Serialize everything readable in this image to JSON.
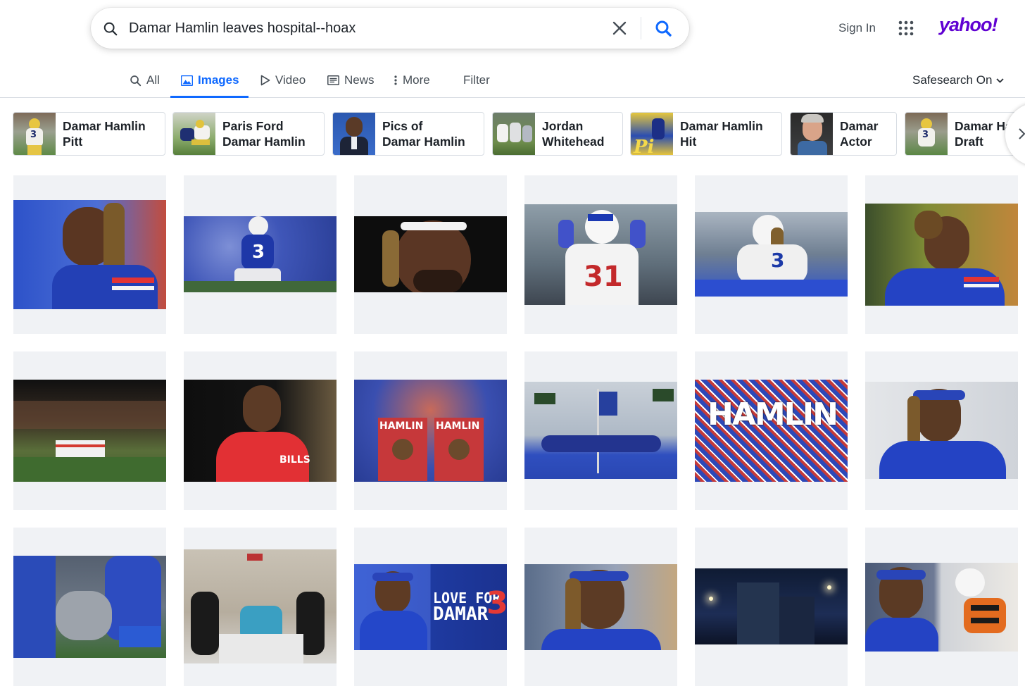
{
  "search": {
    "query": "Damar Hamlin leaves hospital--hoax",
    "clear_icon": "close-icon",
    "submit_icon": "search-icon"
  },
  "header": {
    "sign_in": "Sign In",
    "apps_icon": "apps-grid-icon",
    "logo": "yahoo!",
    "brand_color": "#6001d2"
  },
  "tabs": [
    {
      "label": "All",
      "icon": "search-icon",
      "active": false
    },
    {
      "label": "Images",
      "icon": "image-icon",
      "active": true
    },
    {
      "label": "Video",
      "icon": "play-icon",
      "active": false
    },
    {
      "label": "News",
      "icon": "newspaper-icon",
      "active": false
    },
    {
      "label": "More",
      "icon": "more-vertical-icon",
      "active": false
    },
    {
      "label": "Filter",
      "icon": "",
      "active": false
    }
  ],
  "safesearch": "Safesearch On",
  "accent_color": "#0f69ff",
  "related": [
    {
      "label": "Damar Hamlin\nPitt"
    },
    {
      "label": "Paris Ford\nDamar Hamlin"
    },
    {
      "label": "Pics of\nDamar Hamlin"
    },
    {
      "label": "Jordan\nWhitehead"
    },
    {
      "label": "Damar Hamlin\nHit"
    },
    {
      "label": "Damar\nActor"
    },
    {
      "label": "Damar Hamlin\nDraft"
    }
  ],
  "results_count": 18
}
